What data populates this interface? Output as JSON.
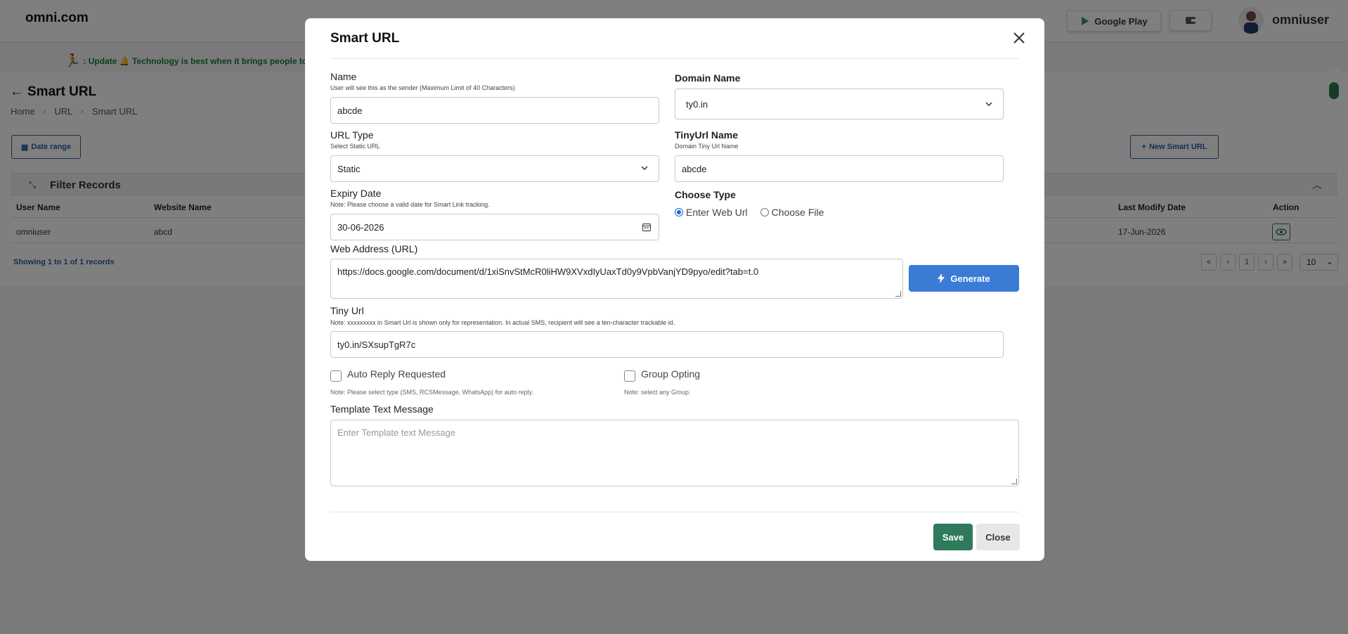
{
  "app": {
    "brand": "omni.com",
    "google_play_label": "Google Play",
    "username": "omniuser",
    "ticker": ": Update 🔔 Technology is best when it brings people to"
  },
  "page": {
    "title": "Smart URL",
    "breadcrumb": [
      "Home",
      "URL",
      "Smart URL"
    ],
    "date_range_label": "Date range",
    "new_button_label": "New Smart URL",
    "filter_title": "Filter Records",
    "table": {
      "columns": [
        "User Name",
        "Website Name",
        "Last Modify Date",
        "Action"
      ],
      "rows": [
        {
          "user_name": "omniuser",
          "website_name": "abcd",
          "last_modify_date": "17-Jun-2026"
        }
      ]
    },
    "showing": "Showing 1 to 1 of 1 records",
    "pager": [
      "«",
      "‹",
      "1",
      "›",
      "»"
    ],
    "page_size": "10"
  },
  "modal": {
    "title": "Smart URL",
    "name": {
      "label": "Name",
      "note": "User will see this as the sender (Maximum Limit of 40 Characters)",
      "value": "abcde"
    },
    "domain": {
      "label": "Domain Name",
      "value": "ty0.in"
    },
    "url_type": {
      "label": "URL Type",
      "note": "Select Static URL",
      "value": "Static"
    },
    "tinyurl_name": {
      "label": "TinyUrl Name",
      "note": "Domain Tiny Url Name",
      "value": "abcde"
    },
    "expiry": {
      "label": "Expiry Date",
      "note": "Note: Please choose a valid date for Smart Link tracking.",
      "value": "30-06-2026"
    },
    "choose_type": {
      "label": "Choose Type",
      "options": [
        "Enter Web Url",
        "Choose File"
      ],
      "selected": "Enter Web Url"
    },
    "web_address": {
      "label": "Web Address (URL)",
      "value": "https://docs.google.com/document/d/1xiSnvStMcR0liHW9XVxdIyUaxTd0y9VpbVanjYD9pyo/edit?tab=t.0"
    },
    "generate_label": "Generate",
    "tiny_url": {
      "label": "Tiny Url",
      "note": "Note: xxxxxxxxx in Smart Url is shown only for representation. In actual SMS, recipient will see a ten-character trackable id.",
      "value": "ty0.in/SXsupTgR7c"
    },
    "auto_reply": {
      "label": "Auto Reply Requested",
      "note": "Note: Please select type (SMS, RCSMessage, WhatsApp) for auto reply.",
      "checked": false
    },
    "group_opting": {
      "label": "Group Opting",
      "note": "Note: select any Group.",
      "checked": false
    },
    "template": {
      "label": "Template Text Message",
      "placeholder": "Enter Template text Message"
    },
    "save_label": "Save",
    "close_label": "Close"
  },
  "colors": {
    "primary": "#3a7bd5",
    "save": "#2f7a5a",
    "link": "#2b5f9e"
  }
}
